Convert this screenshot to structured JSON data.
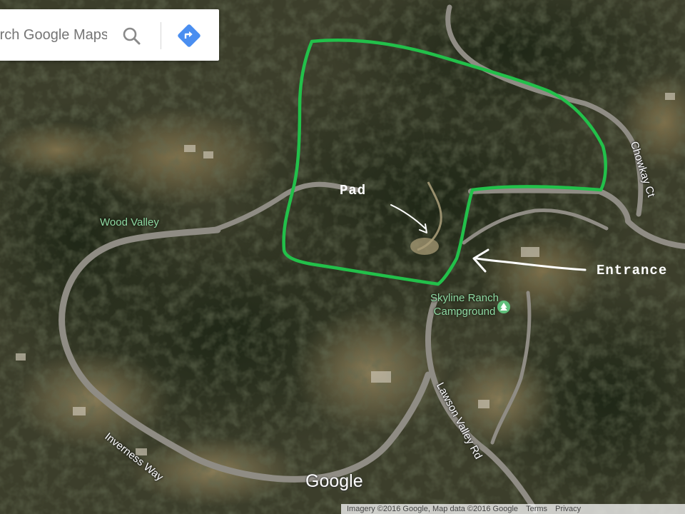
{
  "search": {
    "placeholder": "Search Google Maps"
  },
  "icons": {
    "search": "search-icon",
    "directions": "directions-icon",
    "campground": "campground-icon"
  },
  "colors": {
    "boundary": "#22c04a",
    "directions": "#4a8ef0",
    "place_label": "#8ed8a3",
    "annotation": "#ffffff"
  },
  "map": {
    "type": "satellite",
    "places": {
      "wood_valley": "Wood Valley",
      "campground_line1": "Skyline Ranch",
      "campground_line2": "Campground"
    },
    "roads": {
      "inverness": "Inverness Way",
      "lawson": "Lawson Valley Rd",
      "chowkay": "Chowkay Ct"
    },
    "annotations": {
      "pad": "Pad",
      "entrance": "Entrance"
    }
  },
  "footer": {
    "logo": "Google",
    "imagery": "Imagery ©2016 Google, Map data ©2016 Google",
    "terms": "Terms",
    "privacy": "Privacy"
  }
}
